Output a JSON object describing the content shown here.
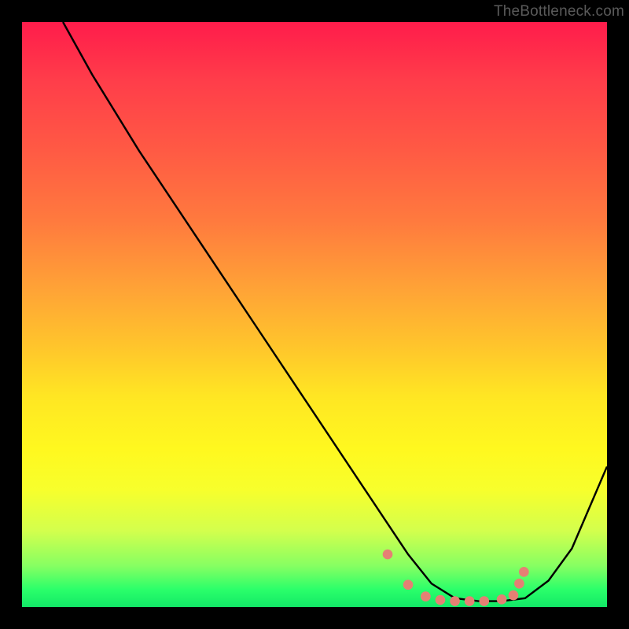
{
  "watermark": "TheBottleneck.com",
  "chart_data": {
    "type": "line",
    "title": "",
    "xlabel": "",
    "ylabel": "",
    "xlim": [
      0,
      100
    ],
    "ylim": [
      0,
      100
    ],
    "series": [
      {
        "name": "curve",
        "x": [
          7,
          12,
          20,
          30,
          40,
          50,
          58,
          62,
          66,
          70,
          74,
          78,
          82,
          86,
          90,
          94,
          100
        ],
        "values": [
          100,
          91,
          78,
          63,
          48,
          33,
          21,
          15,
          9,
          4,
          1.5,
          1,
          1,
          1.5,
          4.5,
          10,
          24
        ]
      }
    ],
    "marker_points": {
      "name": "markers",
      "color": "#e58074",
      "points": [
        {
          "x": 62.5,
          "y": 9.0
        },
        {
          "x": 66.0,
          "y": 3.8
        },
        {
          "x": 69.0,
          "y": 1.8
        },
        {
          "x": 71.5,
          "y": 1.2
        },
        {
          "x": 74.0,
          "y": 1.0
        },
        {
          "x": 76.5,
          "y": 1.0
        },
        {
          "x": 79.0,
          "y": 1.0
        },
        {
          "x": 82.0,
          "y": 1.3
        },
        {
          "x": 84.0,
          "y": 2.0
        },
        {
          "x": 85.0,
          "y": 4.0
        },
        {
          "x": 85.8,
          "y": 6.0
        }
      ]
    },
    "background_gradient": {
      "top": "#ff1c4b",
      "mid": "#ffe623",
      "bottom": "#12e867"
    }
  }
}
